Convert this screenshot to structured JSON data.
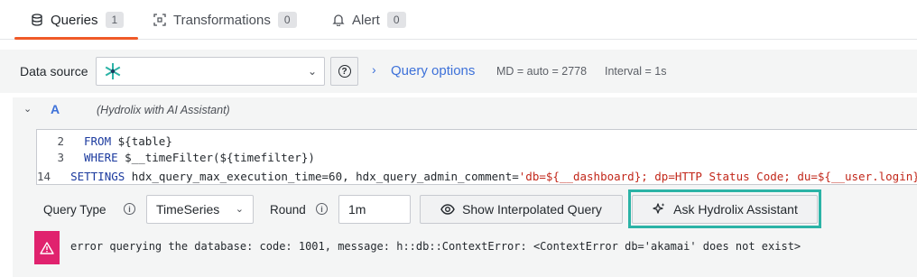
{
  "tabs": [
    {
      "label": "Queries",
      "count": "1",
      "icon": "database-icon"
    },
    {
      "label": "Transformations",
      "count": "0",
      "icon": "transform-icon"
    },
    {
      "label": "Alert",
      "count": "0",
      "icon": "bell-icon"
    }
  ],
  "toolbar": {
    "data_source_label": "Data source",
    "data_source_icon": "hydrolix-logo",
    "help_icon": "help-icon",
    "query_options_label": "Query options",
    "md_info": "MD = auto = 2778",
    "interval_info": "Interval = 1s"
  },
  "query": {
    "ref_id": "A",
    "datasource_name": "(Hydrolix with AI Assistant)",
    "lines": [
      {
        "num": "2",
        "kw": "FROM ",
        "rest": "${table}"
      },
      {
        "num": "3",
        "kw": "WHERE ",
        "rest": "$__timeFilter(${timefilter})"
      },
      {
        "num": "14",
        "kw": "SETTINGS ",
        "rest": "hdx_query_max_execution_time=60, hdx_query_admin_comment=",
        "str": "'db=${__dashboard}; dp=HTTP Status Code; du=${__user.login}'"
      }
    ]
  },
  "controls": {
    "query_type_label": "Query Type",
    "query_type_value": "TimeSeries",
    "round_label": "Round",
    "round_value": "1m",
    "interpolated_button": "Show Interpolated Query",
    "assistant_button": "Ask Hydrolix Assistant"
  },
  "error": {
    "message": "error querying the database: code: 1001, message: h::db::ContextError: <ContextError db='akamai' does not exist>"
  },
  "colors": {
    "accent": "#3d71d9",
    "active_tab_underline": "#f05a28",
    "highlight": "#2bb3a6",
    "error": "#e0226e"
  }
}
